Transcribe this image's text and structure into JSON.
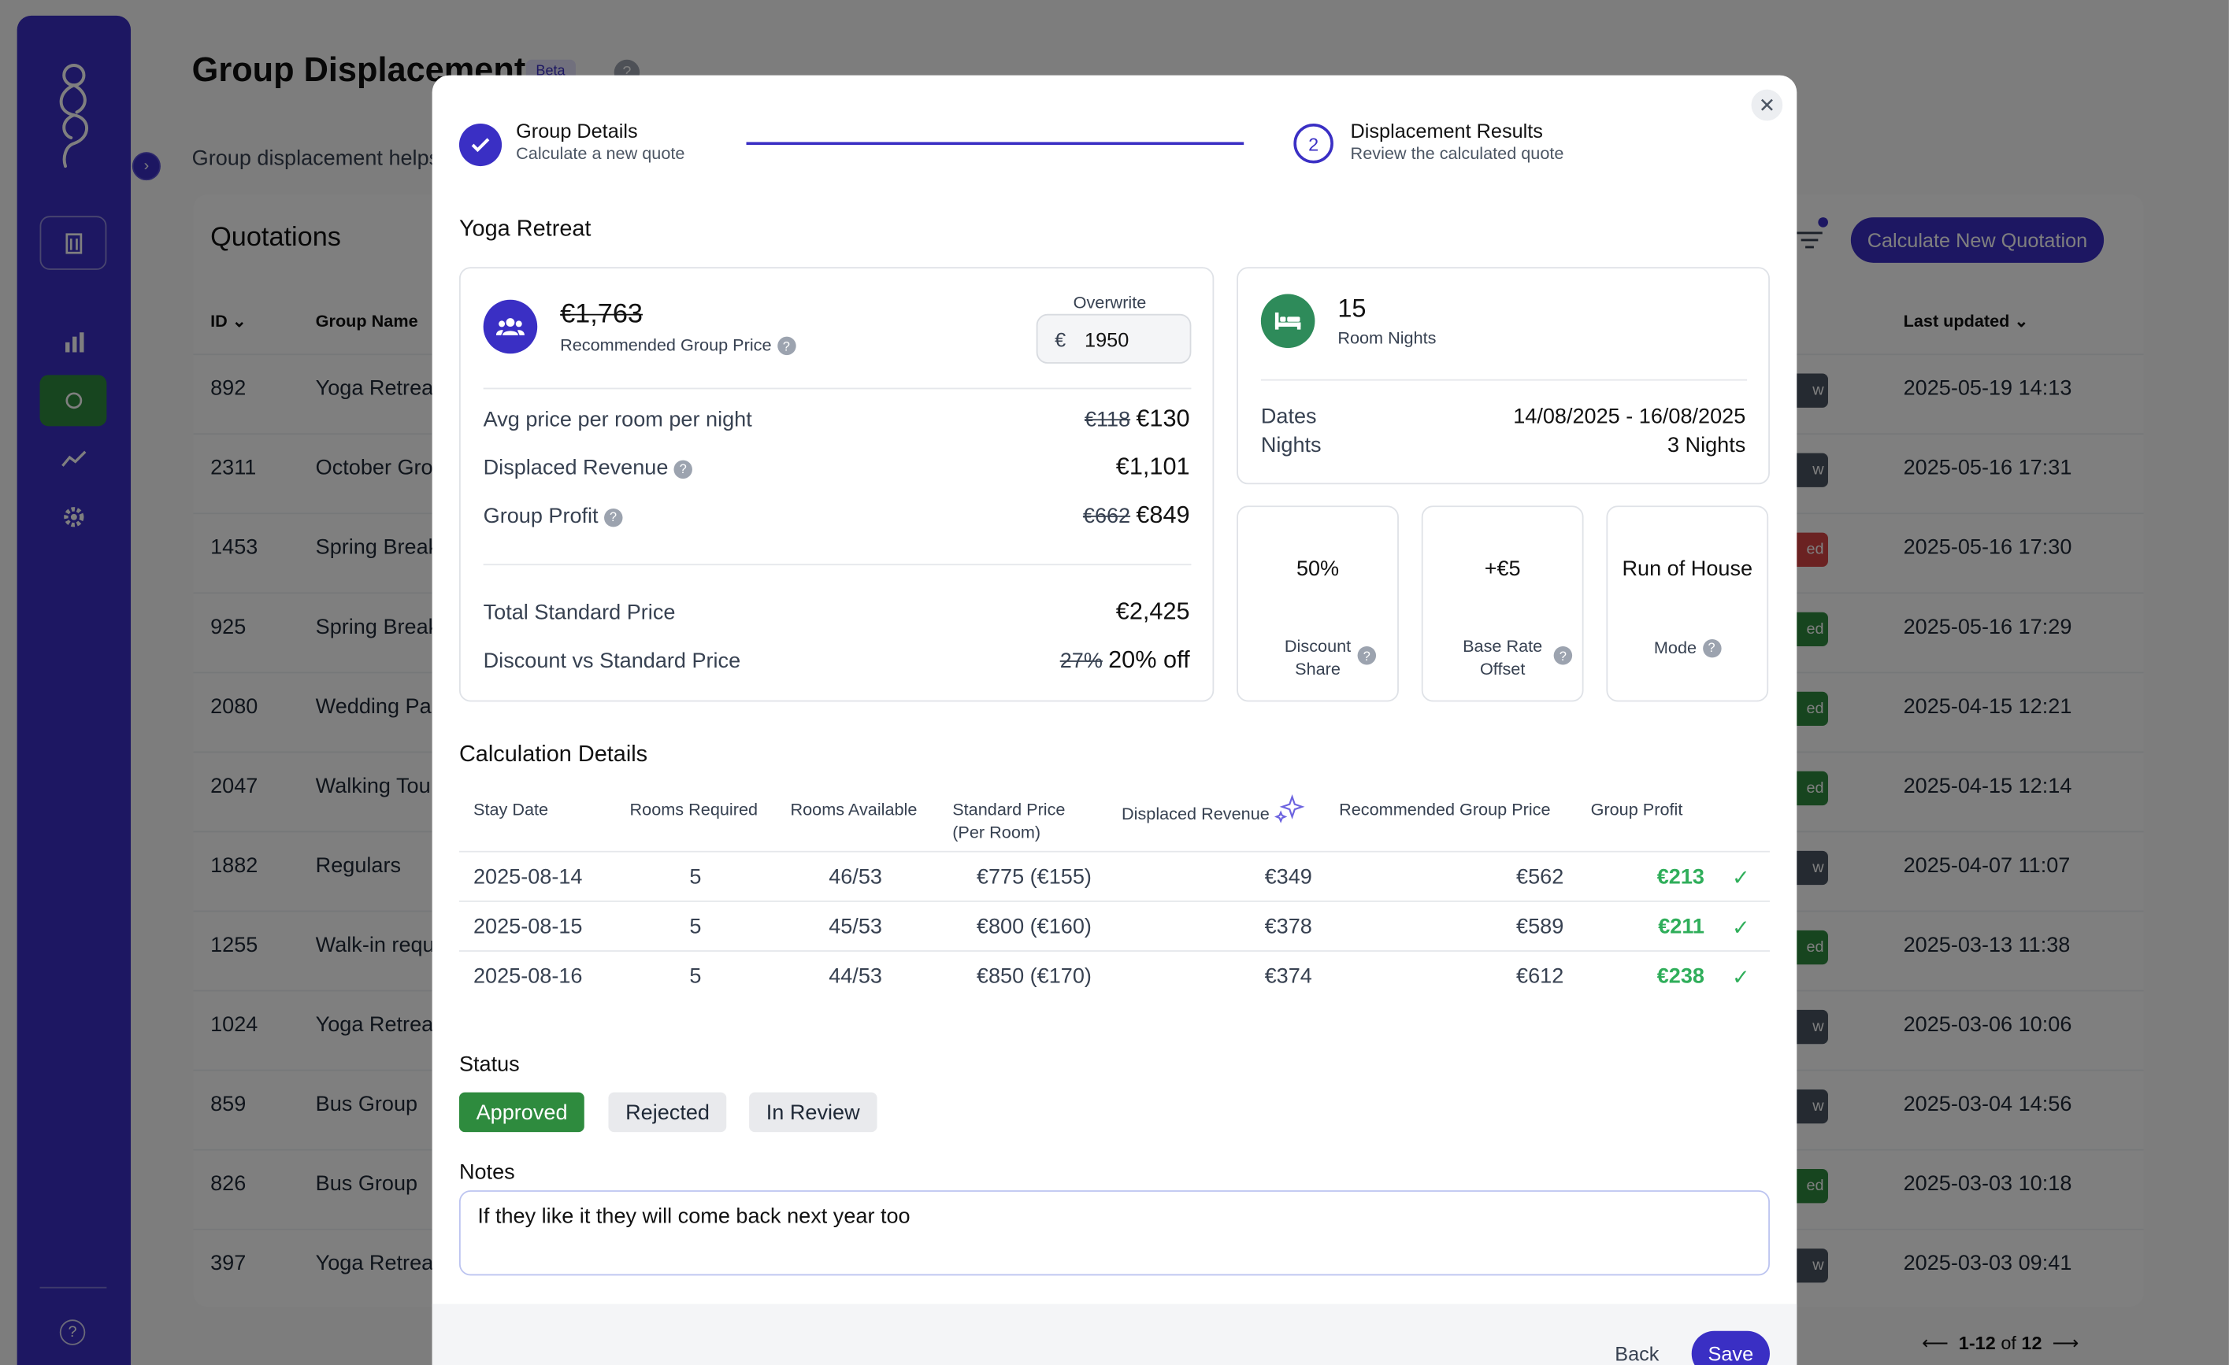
{
  "page": {
    "title": "Group Displacement",
    "beta_label": "Beta",
    "description": "Group displacement helps"
  },
  "sidebar": {
    "help": "?"
  },
  "quotations": {
    "title": "Quotations",
    "calc_button": "Calculate New Quotation",
    "headers": {
      "id": "ID",
      "group_name": "Group Name",
      "last_updated": "Last updated"
    },
    "rows": [
      {
        "id": "892",
        "name": "Yoga Retreat",
        "status_frag": "w",
        "status_color": "#4b5563",
        "updated": "2025-05-19 14:13"
      },
      {
        "id": "2311",
        "name": "October Gro",
        "status_frag": "w",
        "status_color": "#4b5563",
        "updated": "2025-05-16 17:31"
      },
      {
        "id": "1453",
        "name": "Spring Break",
        "status_frag": "ed",
        "status_color": "#d64545",
        "updated": "2025-05-16 17:30"
      },
      {
        "id": "925",
        "name": "Spring Break",
        "status_frag": "ed",
        "status_color": "#2e8b3e",
        "updated": "2025-05-16 17:29"
      },
      {
        "id": "2080",
        "name": "Wedding Pa",
        "status_frag": "ed",
        "status_color": "#2e8b3e",
        "updated": "2025-04-15 12:21"
      },
      {
        "id": "2047",
        "name": "Walking Tou",
        "status_frag": "ed",
        "status_color": "#2e8b3e",
        "updated": "2025-04-15 12:14"
      },
      {
        "id": "1882",
        "name": "Regulars",
        "status_frag": "w",
        "status_color": "#4b5563",
        "updated": "2025-04-07 11:07"
      },
      {
        "id": "1255",
        "name": "Walk-in requ",
        "status_frag": "ed",
        "status_color": "#2e8b3e",
        "updated": "2025-03-13 11:38"
      },
      {
        "id": "1024",
        "name": "Yoga Retreat",
        "status_frag": "w",
        "status_color": "#4b5563",
        "updated": "2025-03-06 10:06"
      },
      {
        "id": "859",
        "name": "Bus Group",
        "status_frag": "w",
        "status_color": "#4b5563",
        "updated": "2025-03-04 14:56"
      },
      {
        "id": "826",
        "name": "Bus Group",
        "status_frag": "ed",
        "status_color": "#2e8b3e",
        "updated": "2025-03-03 10:18"
      },
      {
        "id": "397",
        "name": "Yoga Retreat",
        "status_frag": "w",
        "status_color": "#4b5563",
        "updated": "2025-03-03 09:41"
      }
    ],
    "pagination": {
      "range": "1-12",
      "of": "of",
      "total": "12"
    }
  },
  "modal": {
    "step1": {
      "title": "Group Details",
      "subtitle": "Calculate a new quote"
    },
    "step2": {
      "number": "2",
      "title": "Displacement Results",
      "subtitle": "Review the calculated quote"
    },
    "group_name": "Yoga Retreat",
    "recommended": {
      "old_price": "€1,763",
      "label": "Recommended Group Price",
      "overwrite_label": "Overwrite",
      "currency": "€",
      "overwrite_value": "1950"
    },
    "metrics": [
      {
        "label": "Avg price per room per night",
        "old": "€118",
        "value": "€130",
        "help": false
      },
      {
        "label": "Displaced Revenue",
        "old": "",
        "value": "€1,101",
        "help": true
      },
      {
        "label": "Group Profit",
        "old": "€662",
        "value": "€849",
        "help": true
      }
    ],
    "totals": [
      {
        "label": "Total Standard Price",
        "old": "",
        "value": "€2,425"
      },
      {
        "label": "Discount vs Standard Price",
        "old": "27%",
        "value": "20% off"
      }
    ],
    "room_nights": {
      "value": "15",
      "label": "Room Nights"
    },
    "dates": {
      "label": "Dates",
      "value": "14/08/2025 - 16/08/2025"
    },
    "nights": {
      "label": "Nights",
      "value": "3 Nights"
    },
    "discount_share": {
      "value": "50%",
      "label_l1": "Discount",
      "label_l2": "Share"
    },
    "base_rate_offset": {
      "value": "+€5",
      "label_l1": "Base Rate",
      "label_l2": "Offset"
    },
    "mode": {
      "value": "Run of House",
      "label": "Mode"
    },
    "calc_title": "Calculation Details",
    "calc_headers": {
      "stay_date": "Stay Date",
      "rooms_required": "Rooms Required",
      "rooms_available": "Rooms Available",
      "standard_price_l1": "Standard Price",
      "standard_price_l2": "(Per Room)",
      "displaced_revenue": "Displaced Revenue",
      "recommended_group_price": "Recommended Group Price",
      "group_profit": "Group Profit"
    },
    "calc_rows": [
      {
        "date": "2025-08-14",
        "required": "5",
        "available": "46/53",
        "standard": "€775 (€155)",
        "displaced": "€349",
        "recommended": "€562",
        "profit": "€213"
      },
      {
        "date": "2025-08-15",
        "required": "5",
        "available": "45/53",
        "standard": "€800 (€160)",
        "displaced": "€378",
        "recommended": "€589",
        "profit": "€211"
      },
      {
        "date": "2025-08-16",
        "required": "5",
        "available": "44/53",
        "standard": "€850 (€170)",
        "displaced": "€374",
        "recommended": "€612",
        "profit": "€238"
      }
    ],
    "status_label": "Status",
    "status_options": [
      {
        "label": "Approved",
        "active": true
      },
      {
        "label": "Rejected",
        "active": false
      },
      {
        "label": "In Review",
        "active": false
      }
    ],
    "notes_label": "Notes",
    "notes_value": "If they like it they will come back next year too",
    "back_label": "Back",
    "save_label": "Save"
  },
  "colors": {
    "brand": "#3a2fc4",
    "success": "#2fae5a",
    "approved": "#2e8b3e",
    "rejected": "#d64545"
  }
}
